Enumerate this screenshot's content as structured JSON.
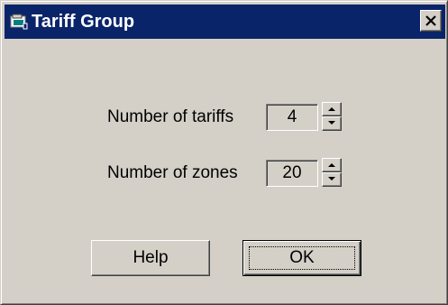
{
  "window": {
    "title": "Tariff Group",
    "icon": "app-icon",
    "close_icon": "close-icon"
  },
  "form": {
    "tariffs_label": "Number of tariffs",
    "tariffs_value": "4",
    "zones_label": "Number of zones",
    "zones_value": "20"
  },
  "buttons": {
    "help": "Help",
    "ok": "OK"
  },
  "colors": {
    "titlebar": "#0a246a",
    "face": "#d4d0c8"
  }
}
